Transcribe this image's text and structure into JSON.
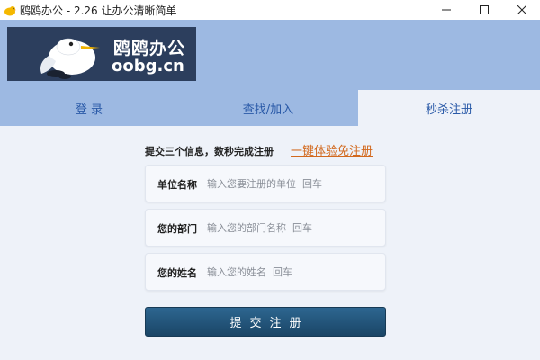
{
  "window": {
    "title": "鸥鸥办公 - 2.26 让办公清晰简单"
  },
  "logo": {
    "name": "鸥鸥办公",
    "domain": "oobg.cn"
  },
  "tabs": [
    {
      "label": "登 录",
      "active": false
    },
    {
      "label": "查找/加入",
      "active": false
    },
    {
      "label": "秒杀注册",
      "active": true
    }
  ],
  "register": {
    "info_text": "提交三个信息，数秒完成注册",
    "try_link": "一键体验免注册",
    "fields": [
      {
        "label": "单位名称",
        "placeholder": "输入您要注册的单位  回车"
      },
      {
        "label": "您的部门",
        "placeholder": "输入您的部门名称  回车"
      },
      {
        "label": "您的姓名",
        "placeholder": "输入您的姓名  回车"
      }
    ],
    "submit_label": "提交注册"
  },
  "colors": {
    "header_bg": "#9db9e2",
    "logo_bg": "#2c3e5d",
    "tab_text": "#2a5aa8",
    "link": "#d2691e",
    "button": "#1f4e74"
  },
  "icons": {
    "app": "bird-icon",
    "minimize": "minimize-icon",
    "maximize": "maximize-icon",
    "close": "close-icon",
    "mascot": "seagull-mascot"
  }
}
